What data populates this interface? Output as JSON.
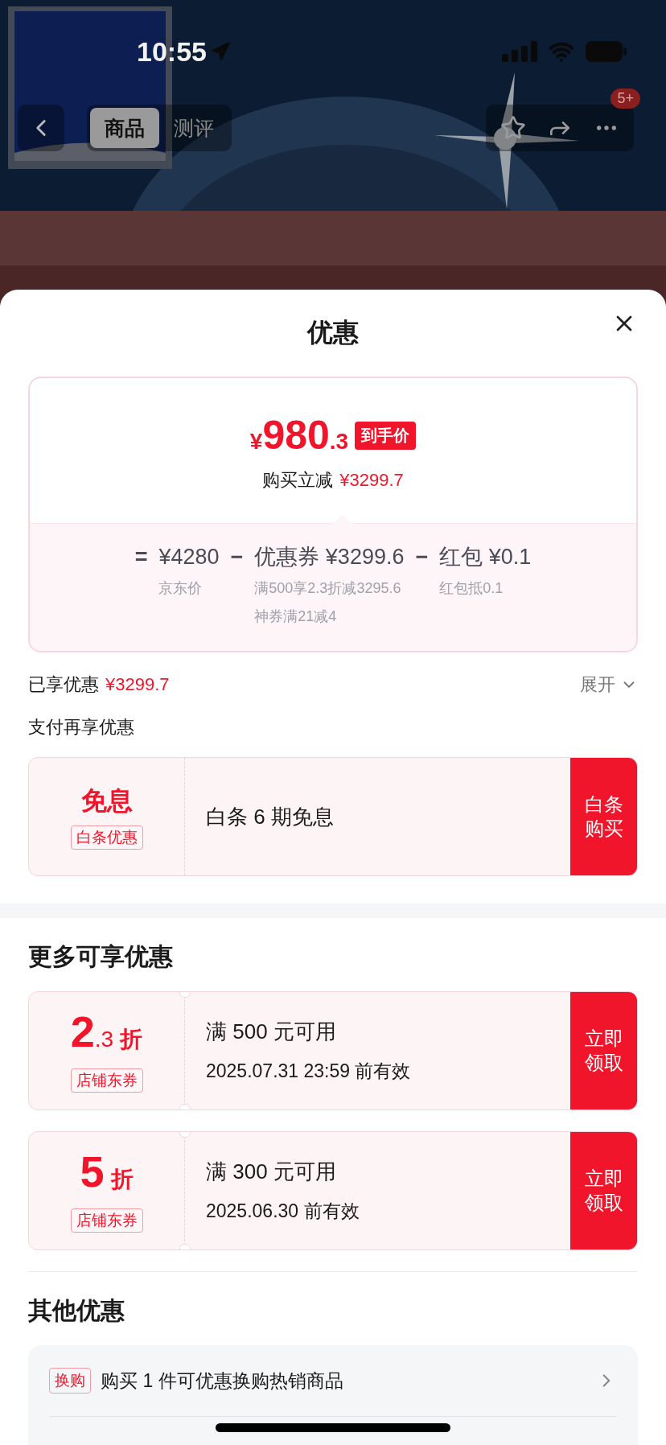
{
  "status_bar": {
    "time": "10:55"
  },
  "nav": {
    "tabs": [
      {
        "label": "商品",
        "selected": true
      },
      {
        "label": "测评",
        "selected": false
      }
    ],
    "more_badge": "5+"
  },
  "sheet": {
    "title": "优惠",
    "price_card": {
      "currency": "¥",
      "price_int": "980",
      "price_dec": ".3",
      "price_tag": "到手价",
      "saving_label": "购买立减",
      "saving_value": "¥3299.7",
      "terms": [
        {
          "op": "=",
          "amount": "¥4280",
          "notes": [
            "京东价"
          ]
        },
        {
          "op": "−",
          "name": "优惠券",
          "amount": "¥3299.6",
          "notes": [
            "满500享2.3折减3295.6",
            "神券满21减4"
          ]
        },
        {
          "op": "−",
          "name": "红包",
          "amount": "¥0.1",
          "notes": [
            "红包抵0.1"
          ]
        }
      ]
    },
    "enjoyed": {
      "label": "已享优惠",
      "value": "¥3299.7",
      "toggle": "展开"
    },
    "pay_section": {
      "title": "支付再享优惠",
      "offers": [
        {
          "headline": "免息",
          "tag": "白条优惠",
          "desc": "白条 6 期免息",
          "action": "白条购买"
        }
      ]
    }
  },
  "more": {
    "title": "更多可享优惠",
    "coupons": [
      {
        "big": "2",
        "small": ".3",
        "unit": "折",
        "tag": "店铺东券",
        "condition": "满 500 元可用",
        "validity": "2025.07.31 23:59 前有效",
        "action": "立即领取"
      },
      {
        "big": "5",
        "unit": "折",
        "tag": "店铺东券",
        "condition": "满 300 元可用",
        "validity": "2025.06.30 前有效",
        "action": "立即领取"
      }
    ]
  },
  "other": {
    "title": "其他优惠",
    "items": [
      {
        "tag": "换购",
        "text": "购买 1 件可优惠换购热销商品"
      }
    ]
  }
}
